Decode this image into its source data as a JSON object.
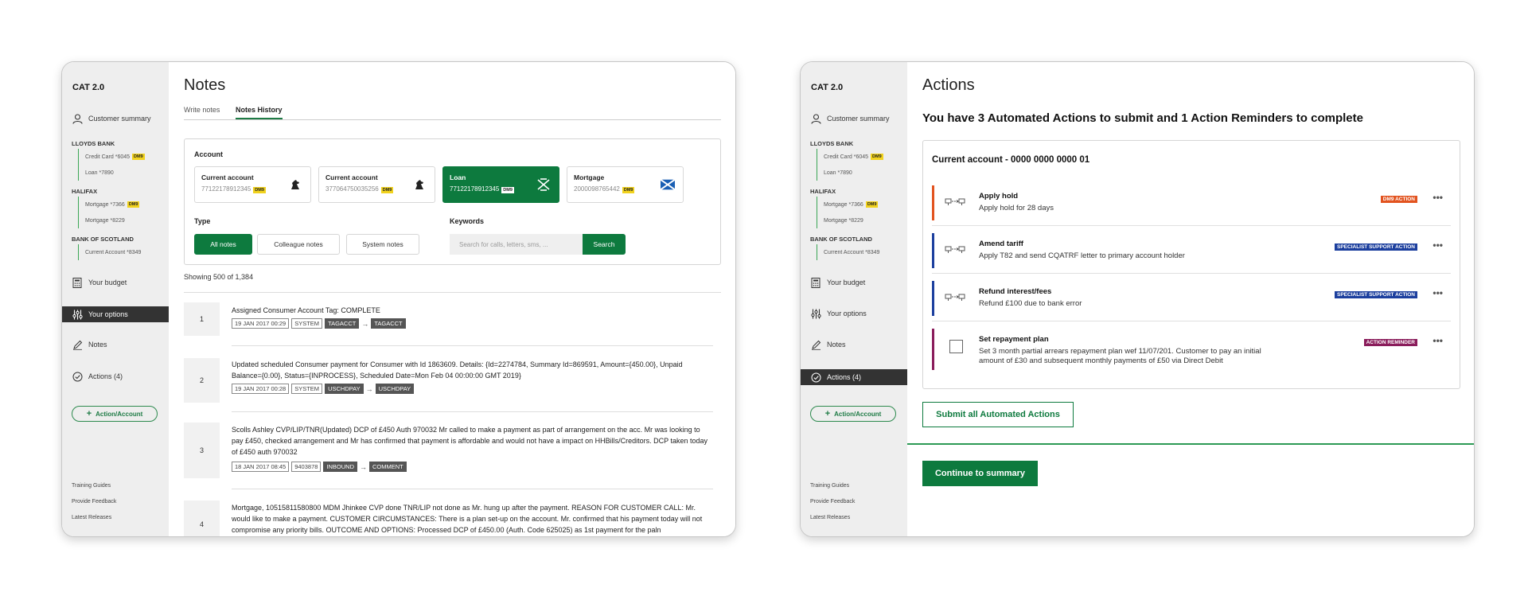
{
  "app_title": "CAT 2.0",
  "sidebar": {
    "customer_summary": "Customer summary",
    "banks": [
      {
        "name": "LLOYDS BANK",
        "items": [
          {
            "label": "Credit Card *6045",
            "badge": "DM9"
          },
          {
            "label": "Loan *7890",
            "badge": ""
          }
        ]
      },
      {
        "name": "HALIFAX",
        "items": [
          {
            "label": "Mortgage *7366",
            "badge": "DM9"
          },
          {
            "label": "Mortgage *8229",
            "badge": ""
          }
        ]
      },
      {
        "name": "BANK OF SCOTLAND",
        "items": [
          {
            "label": "Current Account *8349",
            "badge": ""
          }
        ]
      }
    ],
    "your_budget": "Your budget",
    "your_options": "Your options",
    "notes": "Notes",
    "actions": "Actions (4)",
    "action_account": "Action/Account",
    "footer": [
      "Training Guides",
      "Provide Feedback",
      "Latest Releases"
    ]
  },
  "notes_page": {
    "title": "Notes",
    "tabs": [
      "Write notes",
      "Notes History"
    ],
    "active_tab": "Notes History",
    "account_label": "Account",
    "accounts": [
      {
        "type": "Current account",
        "number": "77122178912345",
        "badge": "DM9",
        "logo": "horse-icon"
      },
      {
        "type": "Current account",
        "number": "377064750035256",
        "badge": "DM9",
        "logo": "horse-icon"
      },
      {
        "type": "Loan",
        "number": "77122178912345",
        "badge": "DM9",
        "logo": "halifax-x-icon",
        "selected": true
      },
      {
        "type": "Mortgage",
        "number": "2000098765442",
        "badge": "DM9",
        "logo": "saltire-icon"
      }
    ],
    "type_label": "Type",
    "type_buttons": [
      "All notes",
      "Colleague notes",
      "System notes"
    ],
    "keywords_label": "Keywords",
    "search_placeholder": "Search for calls, letters, sms, ...",
    "search_button": "Search",
    "showing": "Showing 500 of 1,384",
    "notes": [
      {
        "num": "1",
        "text": "Assigned Consumer Account Tag: COMPLETE",
        "chips": [
          "19 JAN 2017 00:29",
          "SYSTEM",
          "TAGACCT",
          "TAGACCT"
        ]
      },
      {
        "num": "2",
        "text": "Updated scheduled Consumer payment for Consumer with Id 1863609. Details: {Id=2274784, Summary Id=869591, Amount={450.00}, Unpaid Balance={0.00}, Status={INPROCESS}, Scheduled Date=Mon Feb 04 00:00:00 GMT 2019}",
        "chips": [
          "19 JAN 2017 00:28",
          "SYSTEM",
          "USCHDPAY",
          "USCHDPAY"
        ]
      },
      {
        "num": "3",
        "text": "Scolls Ashley CVP/LIP/TNR(Updated) DCP of £450 Auth 970032 Mr called to make a payment as part of arrangement on the acc. Mr was looking to pay £450, checked arrangement and Mr has confirmed that payment is affordable and would not have a impact on HHBills/Creditors. DCP taken today of £450 auth 970032",
        "chips": [
          "18 JAN 2017 08:45",
          "9403878",
          "INBOUND",
          "COMMENT"
        ]
      },
      {
        "num": "4",
        "text": "Mortgage, 10515811580800 MDM Jhinkee CVP done TNR/LIP not done as Mr. hung up after the payment. REASON FOR CUSTOMER CALL: Mr. would like to make a payment. CUSTOMER CIRCUMSTANCES: There is a plan set-up on the account. Mr. confirmed that his payment today will not compromise any priority bills. OUTCOME AND OPTIONS: Processed DCP of £450.00 (Auth. Code 625025) as 1st payment for the paln",
        "chips": []
      }
    ]
  },
  "actions_page": {
    "title": "Actions",
    "heading": "You have 3 Automated Actions to submit and 1 Action Reminders to complete",
    "account_title": "Current account - 0000 0000 0000 01",
    "actions": [
      {
        "title": "Apply hold",
        "desc": "Apply hold for 28 days",
        "badge": "DM9 ACTION",
        "badge_color": "#e2531f",
        "bar_color": "#e2531f",
        "icon": "transfer-icon"
      },
      {
        "title": "Amend tariff",
        "desc": "Apply T82 and send CQATRF letter to primary account holder",
        "badge": "SPECIALIST SUPPORT ACTION",
        "badge_color": "#1c3f9e",
        "bar_color": "#1c3f9e",
        "icon": "transfer-icon"
      },
      {
        "title": "Refund interest/fees",
        "desc": "Refund £100 due to bank error",
        "badge": "SPECIALIST SUPPORT ACTION",
        "badge_color": "#1c3f9e",
        "bar_color": "#1c3f9e",
        "icon": "transfer-icon"
      },
      {
        "title": "Set repayment plan",
        "desc": "Set 3 month partial arrears repayment plan wef 11/07/201. Customer to pay an initial amount of £30 and subsequent monthly payments of £50 via Direct Debit",
        "badge": "ACTION REMINDER",
        "badge_color": "#8a1c5b",
        "bar_color": "#8a1c5b",
        "icon": "checkbox"
      }
    ],
    "more": "•••",
    "submit_button": "Submit all Automated Actions",
    "continue_button": "Continue to summary"
  }
}
